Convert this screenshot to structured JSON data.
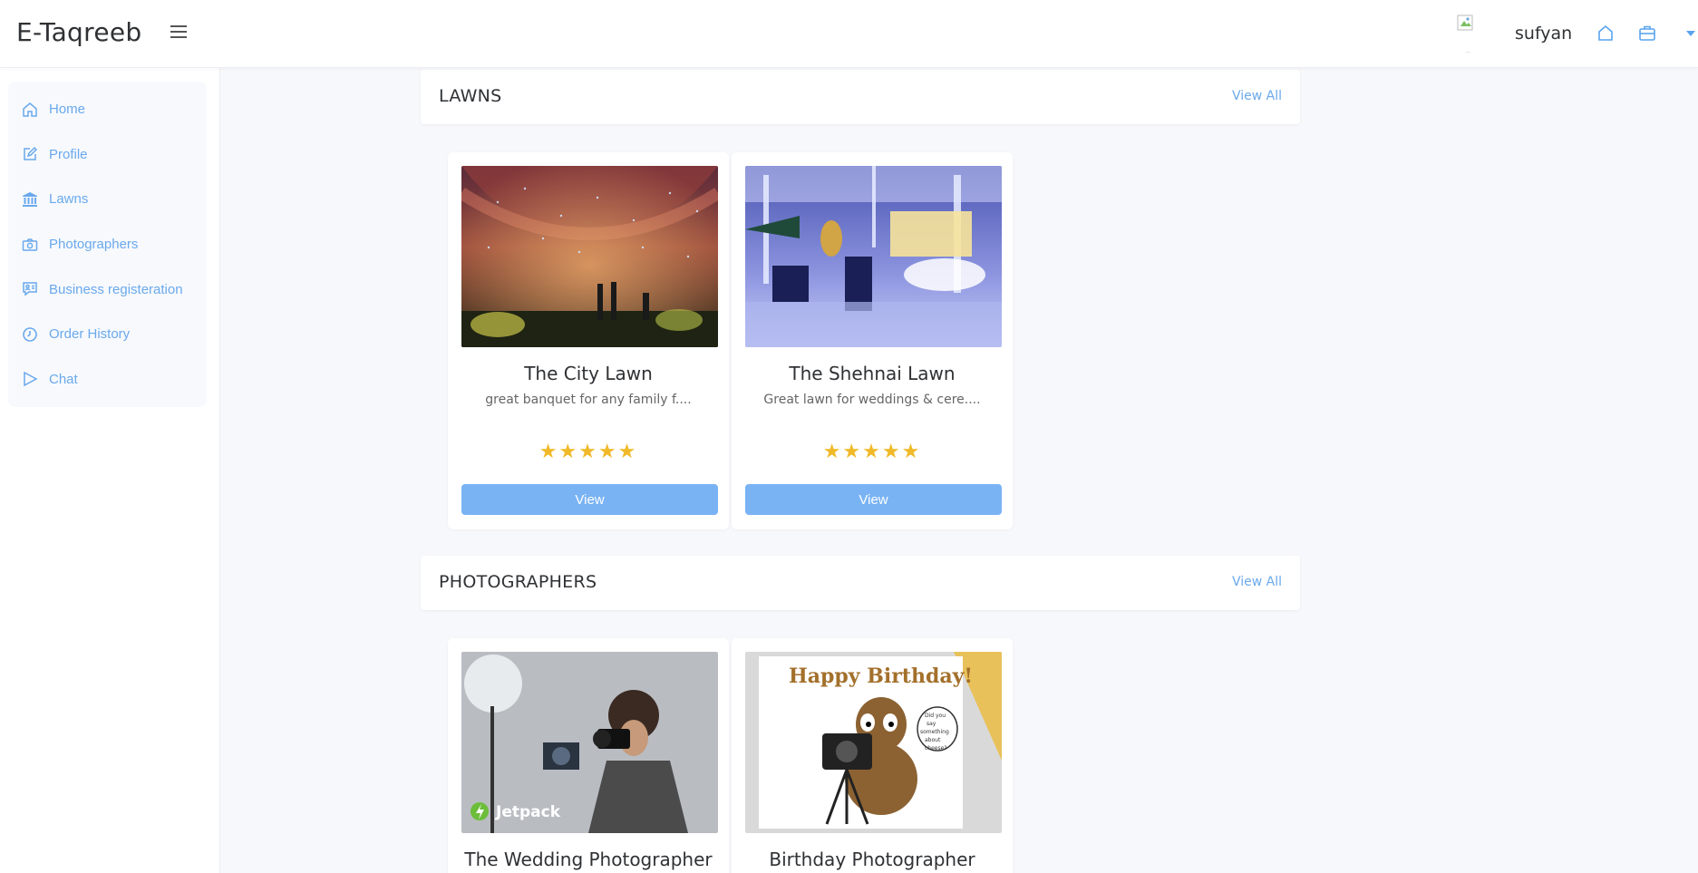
{
  "app": {
    "brand": "E-Taqreeb"
  },
  "header": {
    "username": "sufyan",
    "icons": [
      "menu-icon",
      "home-icon",
      "briefcase-icon",
      "caret-down-icon"
    ]
  },
  "sidebar": {
    "items": [
      {
        "label": "Home",
        "icon": "home-icon"
      },
      {
        "label": "Profile",
        "icon": "edit-icon"
      },
      {
        "label": "Lawns",
        "icon": "bank-icon"
      },
      {
        "label": "Photographers",
        "icon": "camera-icon"
      },
      {
        "label": "Business registeration",
        "icon": "chat-user-icon"
      },
      {
        "label": "Order History",
        "icon": "clock-icon"
      },
      {
        "label": "Chat",
        "icon": "send-icon"
      }
    ]
  },
  "sections": {
    "lawns": {
      "title": "LAWNS",
      "view_all": "View All",
      "cards": [
        {
          "title": "The City Lawn",
          "desc": "great banquet for any family f....",
          "rating": 5,
          "button": "View"
        },
        {
          "title": "The Shehnai Lawn",
          "desc": "Great lawn for weddings & cere....",
          "rating": 5,
          "button": "View"
        }
      ]
    },
    "photographers": {
      "title": "PHOTOGRAPHERS",
      "view_all": "View All",
      "cards": [
        {
          "title": "The Wedding Photographer",
          "image_text": "Jetpack"
        },
        {
          "title": "Birthday Photographer",
          "image_text": "Happy Birthday!",
          "bubble_text": "Did you say something about cheese?"
        }
      ]
    }
  },
  "colors": {
    "accent": "#6aa9ec",
    "button": "#79b3f4",
    "star": "#f0b929"
  }
}
